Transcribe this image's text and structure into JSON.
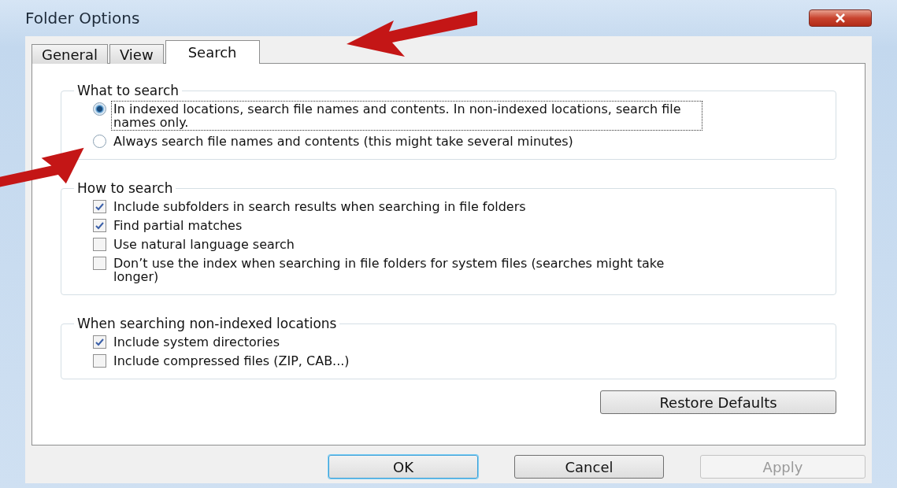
{
  "window": {
    "title": "Folder Options"
  },
  "tabs": [
    {
      "label": "General",
      "selected": false
    },
    {
      "label": "View",
      "selected": false
    },
    {
      "label": "Search",
      "selected": true
    }
  ],
  "groups": [
    {
      "title": "What to search",
      "options": [
        {
          "kind": "radio",
          "label": "In indexed locations, search file names and contents. In non-indexed locations, search file names only.",
          "selected": true,
          "focused": true
        },
        {
          "kind": "radio",
          "label": "Always search file names and contents (this might take several minutes)",
          "selected": false,
          "focused": false
        }
      ]
    },
    {
      "title": "How to search",
      "options": [
        {
          "kind": "checkbox",
          "label": "Include subfolders in search results when searching in file folders",
          "checked": true
        },
        {
          "kind": "checkbox",
          "label": "Find partial matches",
          "checked": true
        },
        {
          "kind": "checkbox",
          "label": "Use natural language search",
          "checked": false
        },
        {
          "kind": "checkbox",
          "label": "Don’t use the index when searching in file folders for system files (searches might take longer)",
          "checked": false
        }
      ]
    },
    {
      "title": "When searching non-indexed locations",
      "options": [
        {
          "kind": "checkbox",
          "label": "Include system directories",
          "checked": true
        },
        {
          "kind": "checkbox",
          "label": "Include compressed files (ZIP, CAB...)",
          "checked": false
        }
      ]
    }
  ],
  "restore_button": "Restore Defaults",
  "buttons": [
    {
      "label": "OK",
      "default": true,
      "disabled": false
    },
    {
      "label": "Cancel",
      "default": false,
      "disabled": false
    },
    {
      "label": "Apply",
      "default": false,
      "disabled": true
    }
  ]
}
